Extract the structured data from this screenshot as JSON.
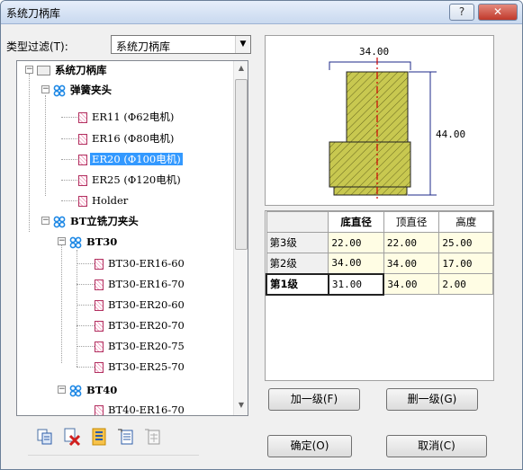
{
  "window": {
    "title": "系统刀柄库",
    "help_label": "?",
    "close_label": "✕"
  },
  "filter": {
    "label": "类型过滤(T):",
    "value": "系统刀柄库"
  },
  "tree": {
    "root": "系统刀柄库",
    "spring": "弹簧夹头",
    "er11": "ER11 (Φ62电机)",
    "er16": "ER16 (Φ80电机)",
    "er20": "ER20 (Φ100电机)",
    "er25": "ER25 (Φ120电机)",
    "holder": "Holder",
    "bt": "BT立铣刀夹头",
    "bt30": "BT30",
    "bt30_1": "BT30-ER16-60",
    "bt30_2": "BT30-ER16-70",
    "bt30_3": "BT30-ER20-60",
    "bt30_4": "BT30-ER20-70",
    "bt30_5": "BT30-ER20-75",
    "bt30_6": "BT30-ER25-70",
    "bt40": "BT40",
    "bt40_1": "BT40-ER16-70"
  },
  "preview": {
    "top_dim": "34.00",
    "side_dim": "44.00"
  },
  "table": {
    "headers": [
      "底直径",
      "顶直径",
      "高度"
    ],
    "rows": [
      {
        "label": "第3级",
        "bottom": "22.00",
        "top": "22.00",
        "height": "25.00"
      },
      {
        "label": "第2级",
        "bottom": "34.00",
        "top": "34.00",
        "height": "17.00"
      },
      {
        "label": "第1级",
        "bottom": "31.00",
        "top": "34.00",
        "height": "2.00"
      }
    ]
  },
  "buttons": {
    "add": "加一级(F)",
    "delete": "删一级(G)",
    "ok": "确定(O)",
    "cancel": "取消(C)"
  },
  "colors": {
    "hatch_fill": "#c8c850",
    "hatch_line": "#6b6b20",
    "axis": "#cc0000",
    "dim_line": "#1d2a8a",
    "selection": "#3399ff"
  }
}
